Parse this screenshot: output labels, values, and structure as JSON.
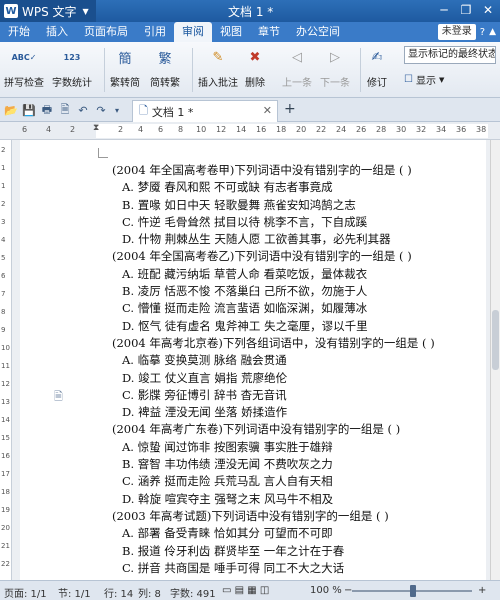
{
  "titlebar": {
    "app_logo": "W",
    "app_name": "WPS 文字",
    "doc_title": "文档 1 *"
  },
  "menu": {
    "items": [
      "开始",
      "插入",
      "页面布局",
      "引用",
      "审阅",
      "视图",
      "章节",
      "办公空间"
    ],
    "active": "审阅",
    "login": "未登录"
  },
  "ribbon": {
    "spell_check": "拼写检查",
    "word_count": "字数统计",
    "trad_to_simp": "繁转简",
    "simp_to_trad": "简转繁",
    "insert_comment": "插入批注",
    "delete": "删除",
    "prev": "上一条",
    "next": "下一条",
    "revise": "修订",
    "show_markup": "显示标记的最终状态",
    "show": "显示"
  },
  "tab": {
    "label": "文档 1 *"
  },
  "ruler": {
    "marks": [
      "6",
      "4",
      "2",
      "",
      "2",
      "4",
      "6",
      "8",
      "10",
      "12",
      "14",
      "16",
      "18",
      "20",
      "22",
      "24",
      "26",
      "28",
      "30",
      "32",
      "34",
      "36",
      "38"
    ]
  },
  "vruler": {
    "marks": [
      "2",
      "1",
      "1",
      "2",
      "3",
      "4",
      "5",
      "6",
      "7",
      "8",
      "9",
      "10",
      "11",
      "12",
      "13",
      "14",
      "15",
      "16",
      "17",
      "18",
      "19",
      "20",
      "21",
      "22",
      "23"
    ]
  },
  "document": {
    "lines": [
      {
        "type": "q",
        "text": "(2004 年全国高考卷甲)下列词语中没有错别字的一组是    ( )"
      },
      {
        "type": "o",
        "text": "A. 梦魇    春风和熙    不可或缺    有志者事竟成"
      },
      {
        "type": "o",
        "text": "B. 置喙    如日中天    轻歌曼舞    燕雀安知鸿鹄之志"
      },
      {
        "type": "o",
        "text": "C. 忤逆    毛骨耸然    拭目以待    桃李不言，下自成蹊"
      },
      {
        "type": "o",
        "text": "D. 什物    荆棘丛生    天随人愿    工欲善其事，必先利其器"
      },
      {
        "type": "q",
        "text": "(2004 年全国高考卷乙)下列词语中没有错别字的一组是    ( )"
      },
      {
        "type": "o",
        "text": "A. 班配    藏污纳垢    草菅人命    看菜吃饭，量体裁衣"
      },
      {
        "type": "o",
        "text": "B. 凌厉    恬恶不悛    不落巢臼    己所不欲，勿施于人"
      },
      {
        "type": "o",
        "text": "C. 懵懂    挺而走险    流言蜚语    如临深渊，如履薄冰"
      },
      {
        "type": "o",
        "text": "D. 怄气    徒有虚名    鬼斧神工    失之毫厘，谬以千里"
      },
      {
        "type": "q",
        "text": "(2004 年高考北京卷)下列各组词语中，没有错别字的一组是    ( )"
      },
      {
        "type": "o",
        "text": "A. 临摹    变换莫测    脉络    融会贯通"
      },
      {
        "type": "o",
        "text": "D. 竣工    仗义直言    娟指    荒廖绝伦"
      },
      {
        "type": "o",
        "text": "C. 影牒    旁征博引    辞书    杳无音讯"
      },
      {
        "type": "o",
        "text": "D. 裨益    湮没无闻    坐落    娇揉造作"
      },
      {
        "type": "q",
        "text": "(2004 年高考广东卷)下列词语中没有错别字的一组是    ( )"
      },
      {
        "type": "o",
        "text": "A. 惊蛰    闻过饰非    按图索骥    事实胜于雄辩"
      },
      {
        "type": "o",
        "text": "B. 窨智    丰功伟绩    湮没无闻    不费吹灰之力"
      },
      {
        "type": "o",
        "text": "C. 涵养    挺而走险    兵荒马乱    言人自有天相"
      },
      {
        "type": "o",
        "text": "D. 斡旋    喧宾夺主    强弩之末    风马牛不相及"
      },
      {
        "type": "q",
        "text": "(2003 年高考试题)下列词语中没有错别字的一组是    ( )"
      },
      {
        "type": "o",
        "text": "A. 部署    备受青睐    恰如其分    可望而不可即"
      },
      {
        "type": "o",
        "text": "B. 报道    伶牙利齿    群贤毕至    一年之计在于春"
      },
      {
        "type": "o",
        "text": "C. 拼音    共商国是    唾手可得    同工不大之大话"
      }
    ]
  },
  "status": {
    "page": "页面: 1/1",
    "section": "节: 1/1",
    "row": "行: 14",
    "col": "列: 8",
    "words": "字数: 491",
    "zoom": "100 %"
  }
}
